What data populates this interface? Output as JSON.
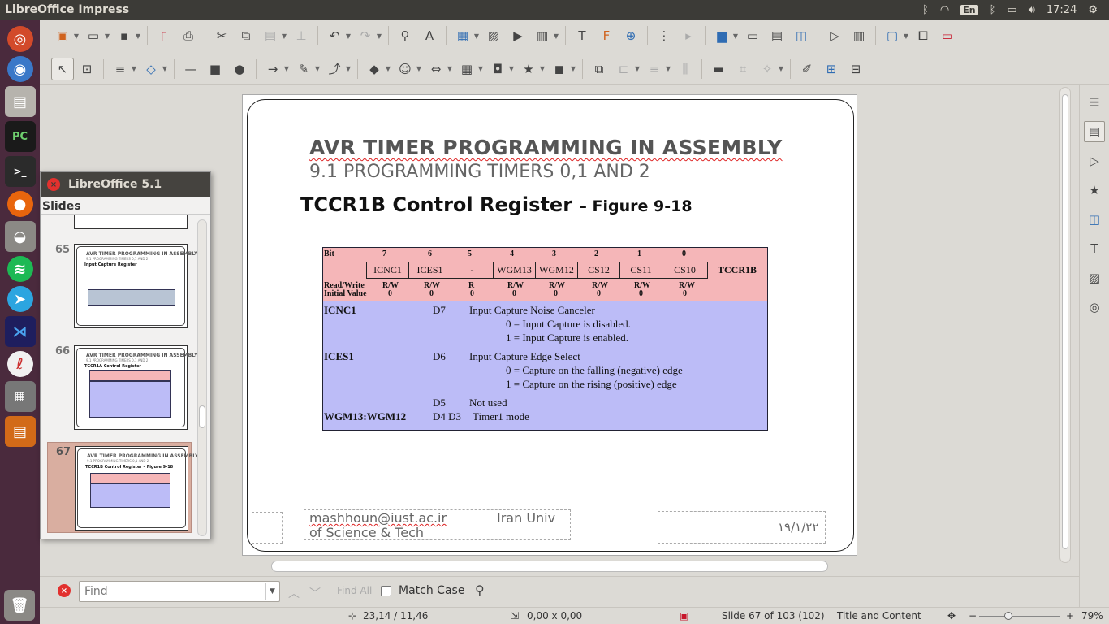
{
  "window": {
    "app_title": "LibreOffice Impress",
    "time": "17:24",
    "keyboard": "En"
  },
  "slides_panel": {
    "window_title": "LibreOffice 5.1",
    "label": "Slides",
    "thumbs": [
      {
        "number": "65",
        "title": "AVR TIMER PROGRAMMING IN ASSEMBLY",
        "subtitle": "9.1 PROGRAMMING TIMERS 0,1 AND 2",
        "heading": "Input Capture Register"
      },
      {
        "number": "66",
        "title": "AVR TIMER PROGRAMMING IN ASSEMBLY",
        "subtitle": "9.1 PROGRAMMING TIMERS 0,1 AND 2",
        "heading": "TCCR1A Control Register"
      },
      {
        "number": "67",
        "title": "AVR TIMER PROGRAMMING IN ASSEMBLY",
        "subtitle": "9.1 PROGRAMMING TIMERS 0,1 AND 2",
        "heading": "TCCR1B Control Register – Figure 9-18"
      }
    ]
  },
  "slide": {
    "title": "AVR TIMER PROGRAMMING IN ASSEMBLY",
    "subtitle": "9.1 PROGRAMMING TIMERS 0,1 AND 2",
    "heading": "TCCR1B Control Register",
    "heading_fig": "– Figure 9-18",
    "footer_left_line1": "mashhoun@iust.ac.ir",
    "footer_left_line1b": "Iran Univ",
    "footer_left_line2": "of Science & Tech",
    "footer_date": "۱۹/۱/۲۲",
    "register": {
      "bit_label": "Bit",
      "bit_numbers": [
        "7",
        "6",
        "5",
        "4",
        "3",
        "2",
        "1",
        "0"
      ],
      "bit_names": [
        "ICNC1",
        "ICES1",
        "-",
        "WGM13",
        "WGM12",
        "CS12",
        "CS11",
        "CS10"
      ],
      "name": "TCCR1B",
      "rw_label": "Read/Write",
      "init_label": "Initial Value",
      "rw_values": [
        "R/W",
        "R/W",
        "R",
        "R/W",
        "R/W",
        "R/W",
        "R/W",
        "R/W"
      ],
      "init_values": [
        "0",
        "0",
        "0",
        "0",
        "0",
        "0",
        "0",
        "0"
      ],
      "descriptions": {
        "icnc1_name": "ICNC1",
        "icnc1_bit": "D7",
        "icnc1_title": "Input Capture Noise Canceler",
        "icnc1_opt0": "0 = Input Capture is disabled.",
        "icnc1_opt1": "1 = Input Capture is enabled.",
        "ices1_name": "ICES1",
        "ices1_bit": "D6",
        "ices1_title": "Input Capture Edge Select",
        "ices1_opt0": "0 = Capture on the falling (negative) edge",
        "ices1_opt1": "1 = Capture on the rising (positive) edge",
        "d5_bit": "D5",
        "d5_title": "Not used",
        "wgm_name": "WGM13:WGM12",
        "wgm_bits": "D4 D3",
        "wgm_title": "Timer1 mode"
      }
    }
  },
  "findbar": {
    "placeholder": "Find",
    "find_all": "Find All",
    "match_case": "Match Case"
  },
  "statusbar": {
    "position": "23,14 / 11,46",
    "size": "0,00 x 0,00",
    "slide_info": "Slide 67 of 103 (102)",
    "layout": "Title and Content",
    "zoom": "79%",
    "zoom_level": 0.79
  }
}
